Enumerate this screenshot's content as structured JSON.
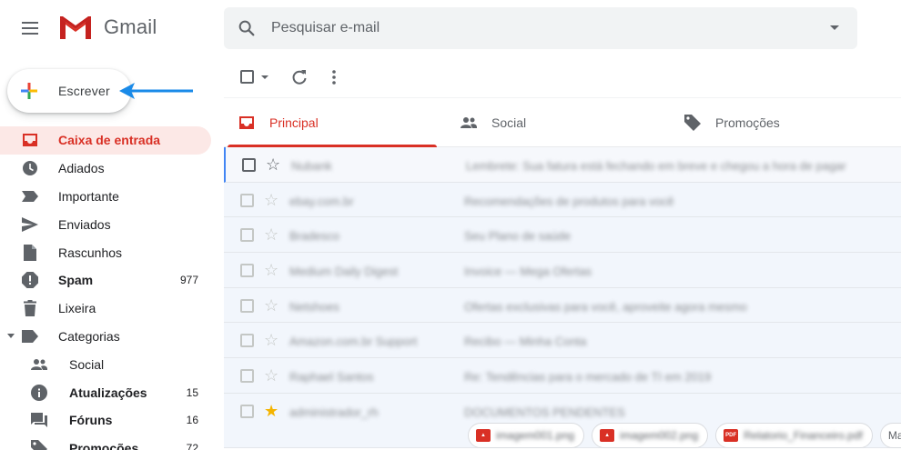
{
  "header": {
    "app_name": "Gmail",
    "search_placeholder": "Pesquisar e-mail"
  },
  "compose": {
    "label": "Escrever"
  },
  "sidebar": {
    "items": [
      {
        "label": "Caixa de entrada",
        "icon": "inbox-icon",
        "count": ""
      },
      {
        "label": "Adiados",
        "icon": "clock-icon",
        "count": ""
      },
      {
        "label": "Importante",
        "icon": "important-icon",
        "count": ""
      },
      {
        "label": "Enviados",
        "icon": "send-icon",
        "count": ""
      },
      {
        "label": "Rascunhos",
        "icon": "draft-icon",
        "count": ""
      },
      {
        "label": "Spam",
        "icon": "spam-icon",
        "count": "977"
      },
      {
        "label": "Lixeira",
        "icon": "trash-icon",
        "count": ""
      },
      {
        "label": "Categorias",
        "icon": "label-icon",
        "count": ""
      }
    ],
    "categories": [
      {
        "label": "Social",
        "icon": "people-icon",
        "count": ""
      },
      {
        "label": "Atualizações",
        "icon": "info-icon",
        "count": "15"
      },
      {
        "label": "Fóruns",
        "icon": "forum-icon",
        "count": "16"
      },
      {
        "label": "Promoções",
        "icon": "tag-icon",
        "count": "72"
      }
    ]
  },
  "tabs": [
    {
      "label": "Principal",
      "icon": "inbox-icon"
    },
    {
      "label": "Social",
      "icon": "people-icon"
    },
    {
      "label": "Promoções",
      "icon": "tag-icon"
    }
  ],
  "emails": [
    {
      "sender": "Nubank",
      "subject": "Lembrete: Sua fatura está fechando em breve e chegou a hora de pagar"
    },
    {
      "sender": "ebay.com.br",
      "subject": "Recomendações de produtos para você"
    },
    {
      "sender": "Bradesco",
      "subject": "Seu Plano de saúde"
    },
    {
      "sender": "Medium Daily Digest",
      "subject": "Invoice — Mega Ofertas"
    },
    {
      "sender": "Netshoes",
      "subject": "Ofertas exclusivas para você, aproveite agora mesmo"
    },
    {
      "sender": "Amazon.com.br Support",
      "subject": "Recibo — Minha Conta"
    },
    {
      "sender": "Raphael Santos",
      "subject": "Re: Tendências para o mercado de TI em 2019"
    },
    {
      "sender": "administrador_rh",
      "subject": "DOCUMENTOS PENDENTES"
    }
  ],
  "attachments": [
    {
      "name": "imagem001.png",
      "type": "image"
    },
    {
      "name": "imagem002.png",
      "type": "image"
    },
    {
      "name": "Relatorio_Financeiro.pdf",
      "type": "pdf"
    }
  ],
  "more_attachments_label": "Mai..."
}
